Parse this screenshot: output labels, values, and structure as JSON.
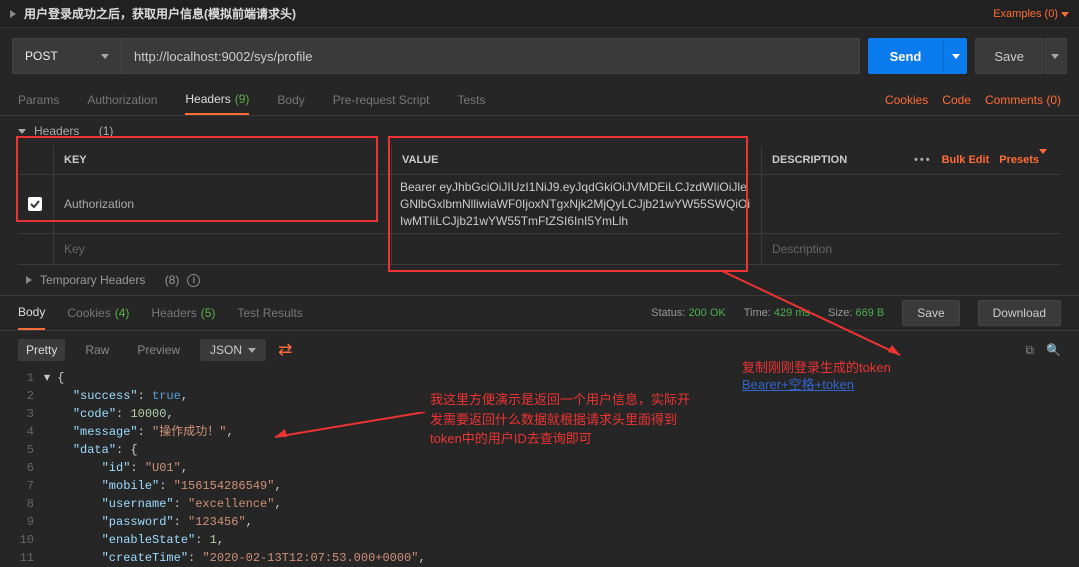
{
  "title": "用户登录成功之后，获取用户信息(模拟前端请求头)",
  "examples": "Examples (0)",
  "method": "POST",
  "url": "http://localhost:9002/sys/profile",
  "sendLabel": "Send",
  "saveLabel": "Save",
  "reqTabs": {
    "params": "Params",
    "auth": "Authorization",
    "headers": "Headers",
    "headersCount": "(9)",
    "body": "Body",
    "prereq": "Pre-request Script",
    "tests": "Tests"
  },
  "rightLinks": {
    "cookies": "Cookies",
    "code": "Code",
    "comments": "Comments (0)"
  },
  "sectionHeaders": {
    "label": "Headers",
    "count": "(1)"
  },
  "table": {
    "keyHead": "KEY",
    "valHead": "VALUE",
    "descHead": "DESCRIPTION",
    "bulk": "Bulk Edit",
    "presets": "Presets",
    "row1Key": "Authorization",
    "row1Val": "Bearer eyJhbGciOiJIUzI1NiJ9.eyJqdGkiOiJVMDEiLCJzdWIiOiJleGNlbGxlbmNlliwiaWF0IjoxNTgxNjk2MjQyLCJjb21wYW55SWQiOiIwMTIiLCJjb21wYW55TmFtZSI6InI5YmLlh",
    "newKey": "Key",
    "newDesc": "Description"
  },
  "tempHeaders": {
    "label": "Temporary Headers",
    "count": "(8)"
  },
  "respTabs": {
    "body": "Body",
    "cookies": "Cookies",
    "cookiesCount": "(4)",
    "headers": "Headers",
    "headersCount": "(5)",
    "tests": "Test Results"
  },
  "status": {
    "statusLabel": "Status:",
    "statusVal": "200 OK",
    "timeLabel": "Time:",
    "timeVal": "429 ms",
    "sizeLabel": "Size:",
    "sizeVal": "669 B",
    "saveBtn": "Save",
    "download": "Download"
  },
  "viewBar": {
    "pretty": "Pretty",
    "raw": "Raw",
    "preview": "Preview",
    "json": "JSON"
  },
  "json": {
    "l1": "{",
    "k2": "\"success\"",
    "v2": "true",
    "k3": "\"code\"",
    "v3": "10000",
    "k4": "\"message\"",
    "v4": "\"操作成功！\"",
    "k5": "\"data\"",
    "k6": "\"id\"",
    "v6": "\"U01\"",
    "k7": "\"mobile\"",
    "v7": "\"156154286549\"",
    "k8": "\"username\"",
    "v8": "\"excellence\"",
    "k9": "\"password\"",
    "v9": "\"123456\"",
    "k10": "\"enableState\"",
    "v10": "1",
    "k11": "\"createTime\"",
    "v11": "\"2020-02-13T12:07:53.000+0000\""
  },
  "annot1": "我这里方便演示是返回一个用户信息，实际开发需要返回什么数据就根据请求头里面得到token中的用户ID去查询即可",
  "annot2": "复制刚刚登录生成的token",
  "annot3": "Bearer+空格+token"
}
